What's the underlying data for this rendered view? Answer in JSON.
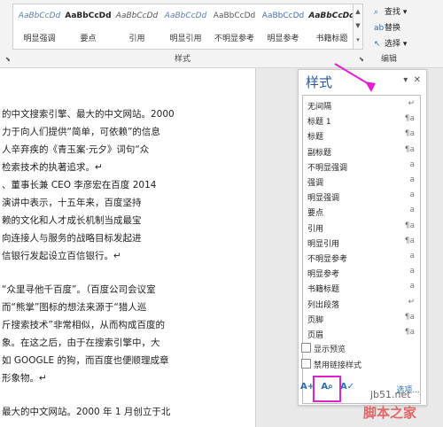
{
  "ribbon": {
    "styles_gallery": [
      {
        "sample": "AaBbCcDd",
        "label": "明显强调",
        "color": "#5b7fb8",
        "italic": true,
        "bold": false
      },
      {
        "sample": "AaBbCcDd",
        "label": "要点",
        "color": "#222222",
        "italic": false,
        "bold": true
      },
      {
        "sample": "AaBbCcDd",
        "label": "引用",
        "color": "#555555",
        "italic": true,
        "bold": false
      },
      {
        "sample": "AaBbCcDd",
        "label": "明显引用",
        "color": "#5b7fb8",
        "italic": true,
        "bold": false
      },
      {
        "sample": "AaBbCcDd",
        "label": "不明显参考",
        "color": "#555555",
        "italic": false,
        "bold": false
      },
      {
        "sample": "AaBbCcDd",
        "label": "明显参考",
        "color": "#4a6fb5",
        "italic": false,
        "bold": false
      },
      {
        "sample": "AaBbCcDd",
        "label": "书籍标题",
        "color": "#222222",
        "italic": true,
        "bold": true
      }
    ],
    "styles_group_label": "样式",
    "editing": {
      "find": "查找",
      "replace": "替换",
      "select": "选择",
      "group_label": "编辑"
    }
  },
  "document": {
    "lines": [
      "的中文搜索引擎、最大的中文网站。2000",
      "力于向人们提供“简单，可依赖”的信息",
      "人辛弃疾的《青玉案·元夕》词句“众",
      "检索技术的执著追求。↵",
      "、董事长兼 CEO 李彦宏在百度 2014",
      "演讲中表示，十五年来，百度坚持",
      "赖的文化和人才成长机制当成最宝",
      "向连接人与服务的战略目标发起进",
      "信银行发起设立百信银行。↵",
      "“众里寻他千百度”。（百度公司会议室",
      "而“熊掌”图标的想法来源于“猎人巡",
      "斤搜索技术”非常相似，从而构成百度的",
      "象。在这之后，由于在搜索引擎中，大",
      "如 GOOGLE 的狗，而百度也便顺理成章",
      "形象物。↵",
      "最大的中文网站。2000 年 1 月创立于北"
    ]
  },
  "styles_pane": {
    "title": "样式",
    "styles": [
      {
        "name": "无间隔",
        "mark": "↵",
        "selected": false
      },
      {
        "name": "标题 1",
        "mark": "¶a",
        "selected": false
      },
      {
        "name": "标题",
        "mark": "¶a",
        "selected": false
      },
      {
        "name": "副标题",
        "mark": "¶a",
        "selected": false
      },
      {
        "name": "不明显强调",
        "mark": "a",
        "selected": false
      },
      {
        "name": "强调",
        "mark": "a",
        "selected": false
      },
      {
        "name": "明显强调",
        "mark": "a",
        "selected": false
      },
      {
        "name": "要点",
        "mark": "a",
        "selected": false
      },
      {
        "name": "引用",
        "mark": "¶a",
        "selected": false
      },
      {
        "name": "明显引用",
        "mark": "¶a",
        "selected": false
      },
      {
        "name": "不明显参考",
        "mark": "a",
        "selected": false
      },
      {
        "name": "明显参考",
        "mark": "a",
        "selected": false
      },
      {
        "name": "书籍标题",
        "mark": "a",
        "selected": false
      },
      {
        "name": "列出段落",
        "mark": "↵",
        "selected": false
      },
      {
        "name": "页脚",
        "mark": "¶a",
        "selected": false
      },
      {
        "name": "页眉",
        "mark": "¶a",
        "selected": false
      }
    ],
    "show_preview": "显示预览",
    "disable_linked": "禁用链接样式",
    "options_link": "选项..."
  },
  "watermark": {
    "site": "jb51.net",
    "name": "脚本之家"
  },
  "annotation_color": "#e020d0"
}
